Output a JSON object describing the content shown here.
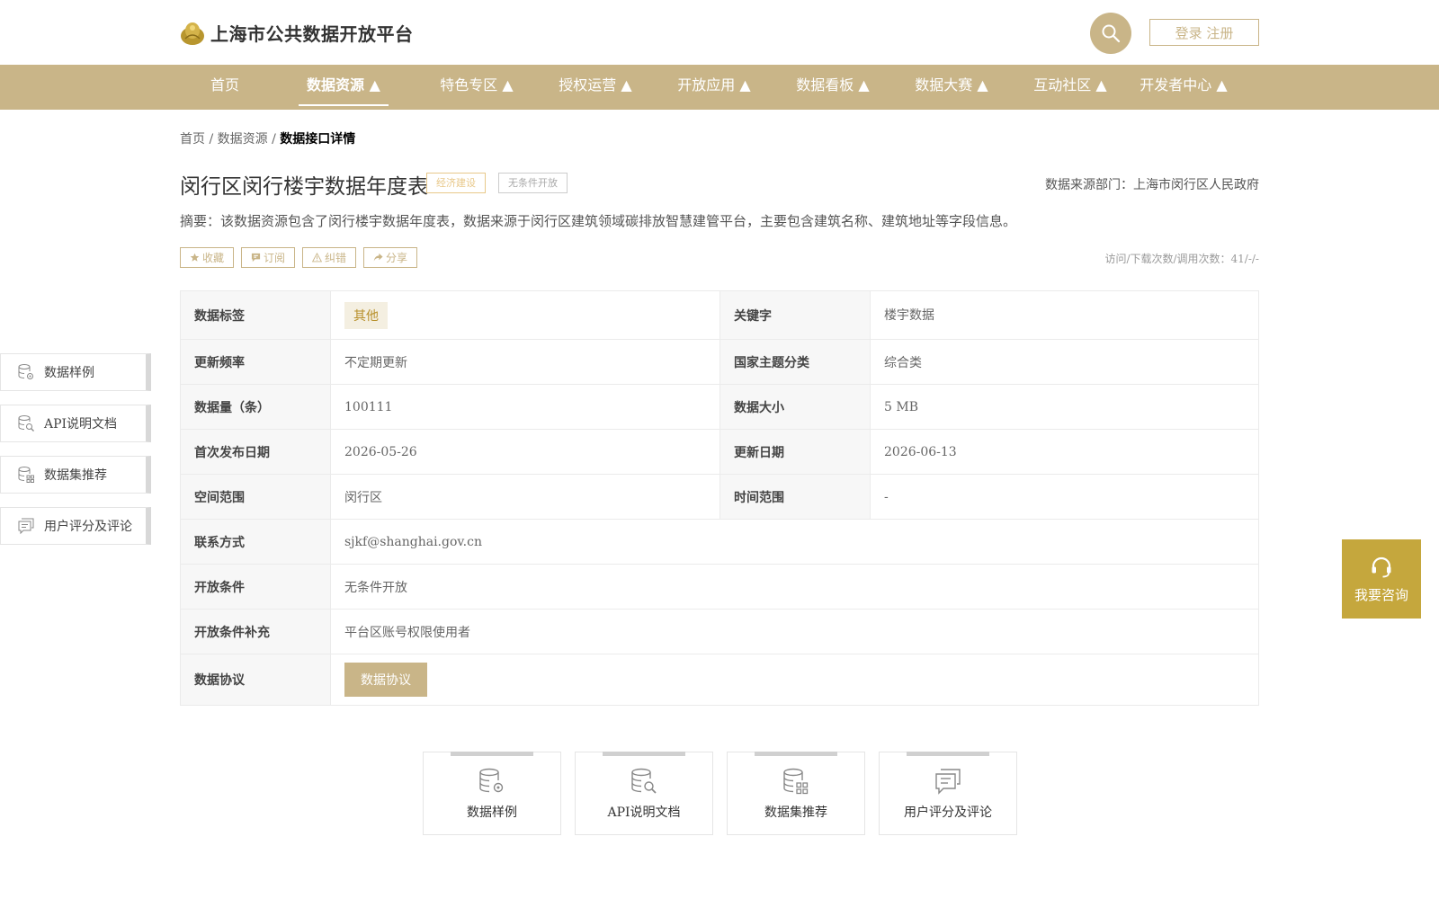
{
  "header": {
    "logo_text": "上海市公共数据开放平台",
    "login_label": "登录 注册"
  },
  "nav": {
    "items": [
      {
        "label": "首页"
      },
      {
        "label": "数据资源 ▲"
      },
      {
        "label": "特色专区 ▲"
      },
      {
        "label": "授权运营 ▲"
      },
      {
        "label": "开放应用 ▲"
      },
      {
        "label": "数据看板 ▲"
      },
      {
        "label": "数据大赛 ▲"
      },
      {
        "label": "互动社区 ▲"
      },
      {
        "label": "开发者中心 ▲"
      }
    ]
  },
  "breadcrumb": {
    "home": "首页",
    "sep1": " / ",
    "section": "数据资源",
    "sep2": " / ",
    "current": "数据接口详情"
  },
  "detail": {
    "title": "闵行区闵行楼宇数据年度表",
    "tag_econ": "经济建设",
    "tag_open": "无条件开放",
    "source": "数据来源部门：上海市闵行区人民政府",
    "summary": "摘要：该数据资源包含了闵行楼宇数据年度表，数据来源于闵行区建筑领域碳排放智慧建管平台，主要包含建筑名称、建筑地址等字段信息。",
    "actions": {
      "favorite": "收藏",
      "subscribe": "订阅",
      "report": "纠错",
      "share": "分享"
    },
    "stats": "访问/下载次数/调用次数：41/-/-"
  },
  "table": {
    "data_tag_label": "数据标签",
    "data_tag_value": "其他",
    "keyword_label": "关键字",
    "keyword_value": "楼宇数据",
    "freq_label": "更新频率",
    "freq_value": "不定期更新",
    "theme_label": "国家主题分类",
    "theme_value": "综合类",
    "count_label": "数据量（条）",
    "count_value": "100111",
    "size_label": "数据大小",
    "size_value": "5 MB",
    "first_date_label": "首次发布日期",
    "first_date_value": "2026-05-26",
    "update_date_label": "更新日期",
    "update_date_value": "2026-06-13",
    "space_label": "空间范围",
    "space_value": "闵行区",
    "time_label": "时间范围",
    "time_value": "-",
    "contact_label": "联系方式",
    "contact_value": "sjkf@shanghai.gov.cn",
    "cond_label": "开放条件",
    "cond_value": "无条件开放",
    "cond_extra_label": "开放条件补充",
    "cond_extra_value": "平台区账号权限使用者",
    "agreement_label": "数据协议",
    "agreement_button": "数据协议"
  },
  "side_menu": {
    "items": [
      {
        "label": "数据样例",
        "icon": "database-gear-icon"
      },
      {
        "label": "API说明文档",
        "icon": "database-search-icon"
      },
      {
        "label": "数据集推荐",
        "icon": "database-grid-icon"
      },
      {
        "label": "用户评分及评论",
        "icon": "comment-icon"
      }
    ]
  },
  "consult": {
    "label": "我要咨询",
    "icon": "headset-icon"
  },
  "bottom_tabs": {
    "items": [
      {
        "label": "数据样例"
      },
      {
        "label": "API说明文档"
      },
      {
        "label": "数据集推荐"
      },
      {
        "label": "用户评分及评论"
      }
    ]
  },
  "colors": {
    "accent": "#c9b588",
    "consult": "#c5a73d",
    "tag_econ": "#e8c88a"
  }
}
